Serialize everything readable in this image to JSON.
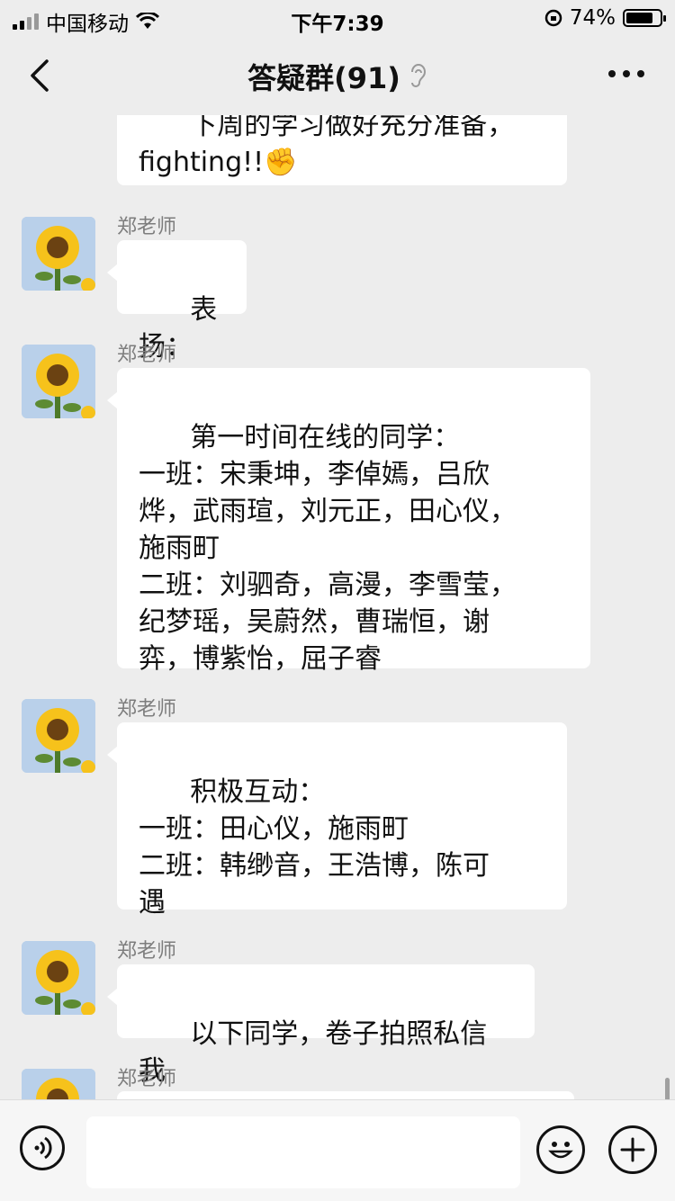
{
  "status_bar": {
    "carrier": "中国移动",
    "time": "下午7:39",
    "battery_percent": "74%",
    "battery_level": 0.74
  },
  "nav": {
    "title": "答疑群(91)",
    "back_icon": "chevron-left-icon",
    "ear_icon": "ear-icon",
    "more_icon": "more-dots-icon"
  },
  "messages": [
    {
      "sender": "",
      "text": "下周的学习做好充分准备，\nfighting!!",
      "emoji": "✊"
    },
    {
      "sender": "郑老师",
      "text": "表扬："
    },
    {
      "sender": "郑老师",
      "text": "第一时间在线的同学：\n一班：宋秉坤，李倬嫣，吕欣\n烨，武雨瑄，刘元正，田心仪，\n施雨町\n二班：刘驷奇，高漫，李雪莹，\n纪梦瑶，吴蔚然，曹瑞恒，谢\n弈，博紫怡，屈子睿"
    },
    {
      "sender": "郑老师",
      "text": "积极互动：\n一班：田心仪，施雨町\n二班：韩缈音，王浩博，陈可\n遇"
    },
    {
      "sender": "郑老师",
      "text": "以下同学，卷子拍照私信我"
    },
    {
      "sender": "郑老师",
      "text": ""
    }
  ],
  "input_bar": {
    "voice_icon": "voice-icon",
    "emoji_icon": "emoji-icon",
    "plus_icon": "plus-icon",
    "placeholder": ""
  }
}
